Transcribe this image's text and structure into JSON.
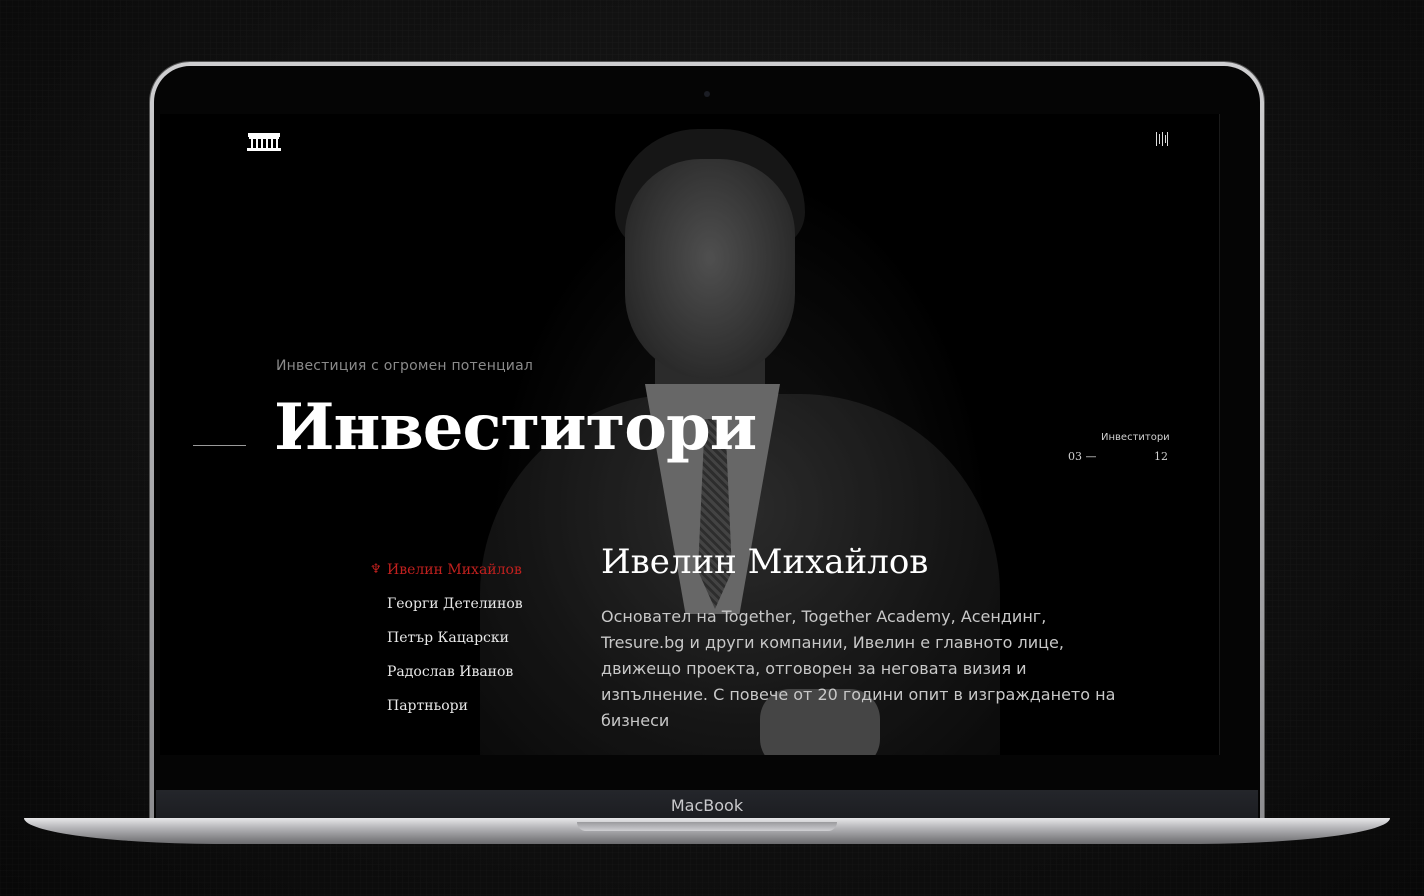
{
  "device": {
    "label": "MacBook"
  },
  "hero": {
    "kicker": "Инвестиция с огромен потенциал",
    "title": "Инвеститори"
  },
  "section_counter": {
    "label": "Инвеститори",
    "current": "03 —",
    "total": "12"
  },
  "investors": {
    "items": [
      {
        "label": "Ивелин Михайлов",
        "active": true
      },
      {
        "label": "Георги Детелинов",
        "active": false
      },
      {
        "label": "Петър Кацарски",
        "active": false
      },
      {
        "label": "Радослав Иванов",
        "active": false
      },
      {
        "label": "Партньори",
        "active": false
      }
    ],
    "active_marker": "♆"
  },
  "profile": {
    "name": "Ивелин Михайлов",
    "bio": "Основател на Together, Together Academy, Асендинг, Tresure.bg и други компании, Ивелин е главното лице, движещо проекта, отговорен за неговата визия и изпълнение. С повече от 20 години опит в изграждането на бизнеси"
  },
  "icons": {
    "logo": "building-logo-icon",
    "menu": "menu-bars-icon"
  },
  "colors": {
    "accent": "#c0201e",
    "background": "#000000"
  }
}
